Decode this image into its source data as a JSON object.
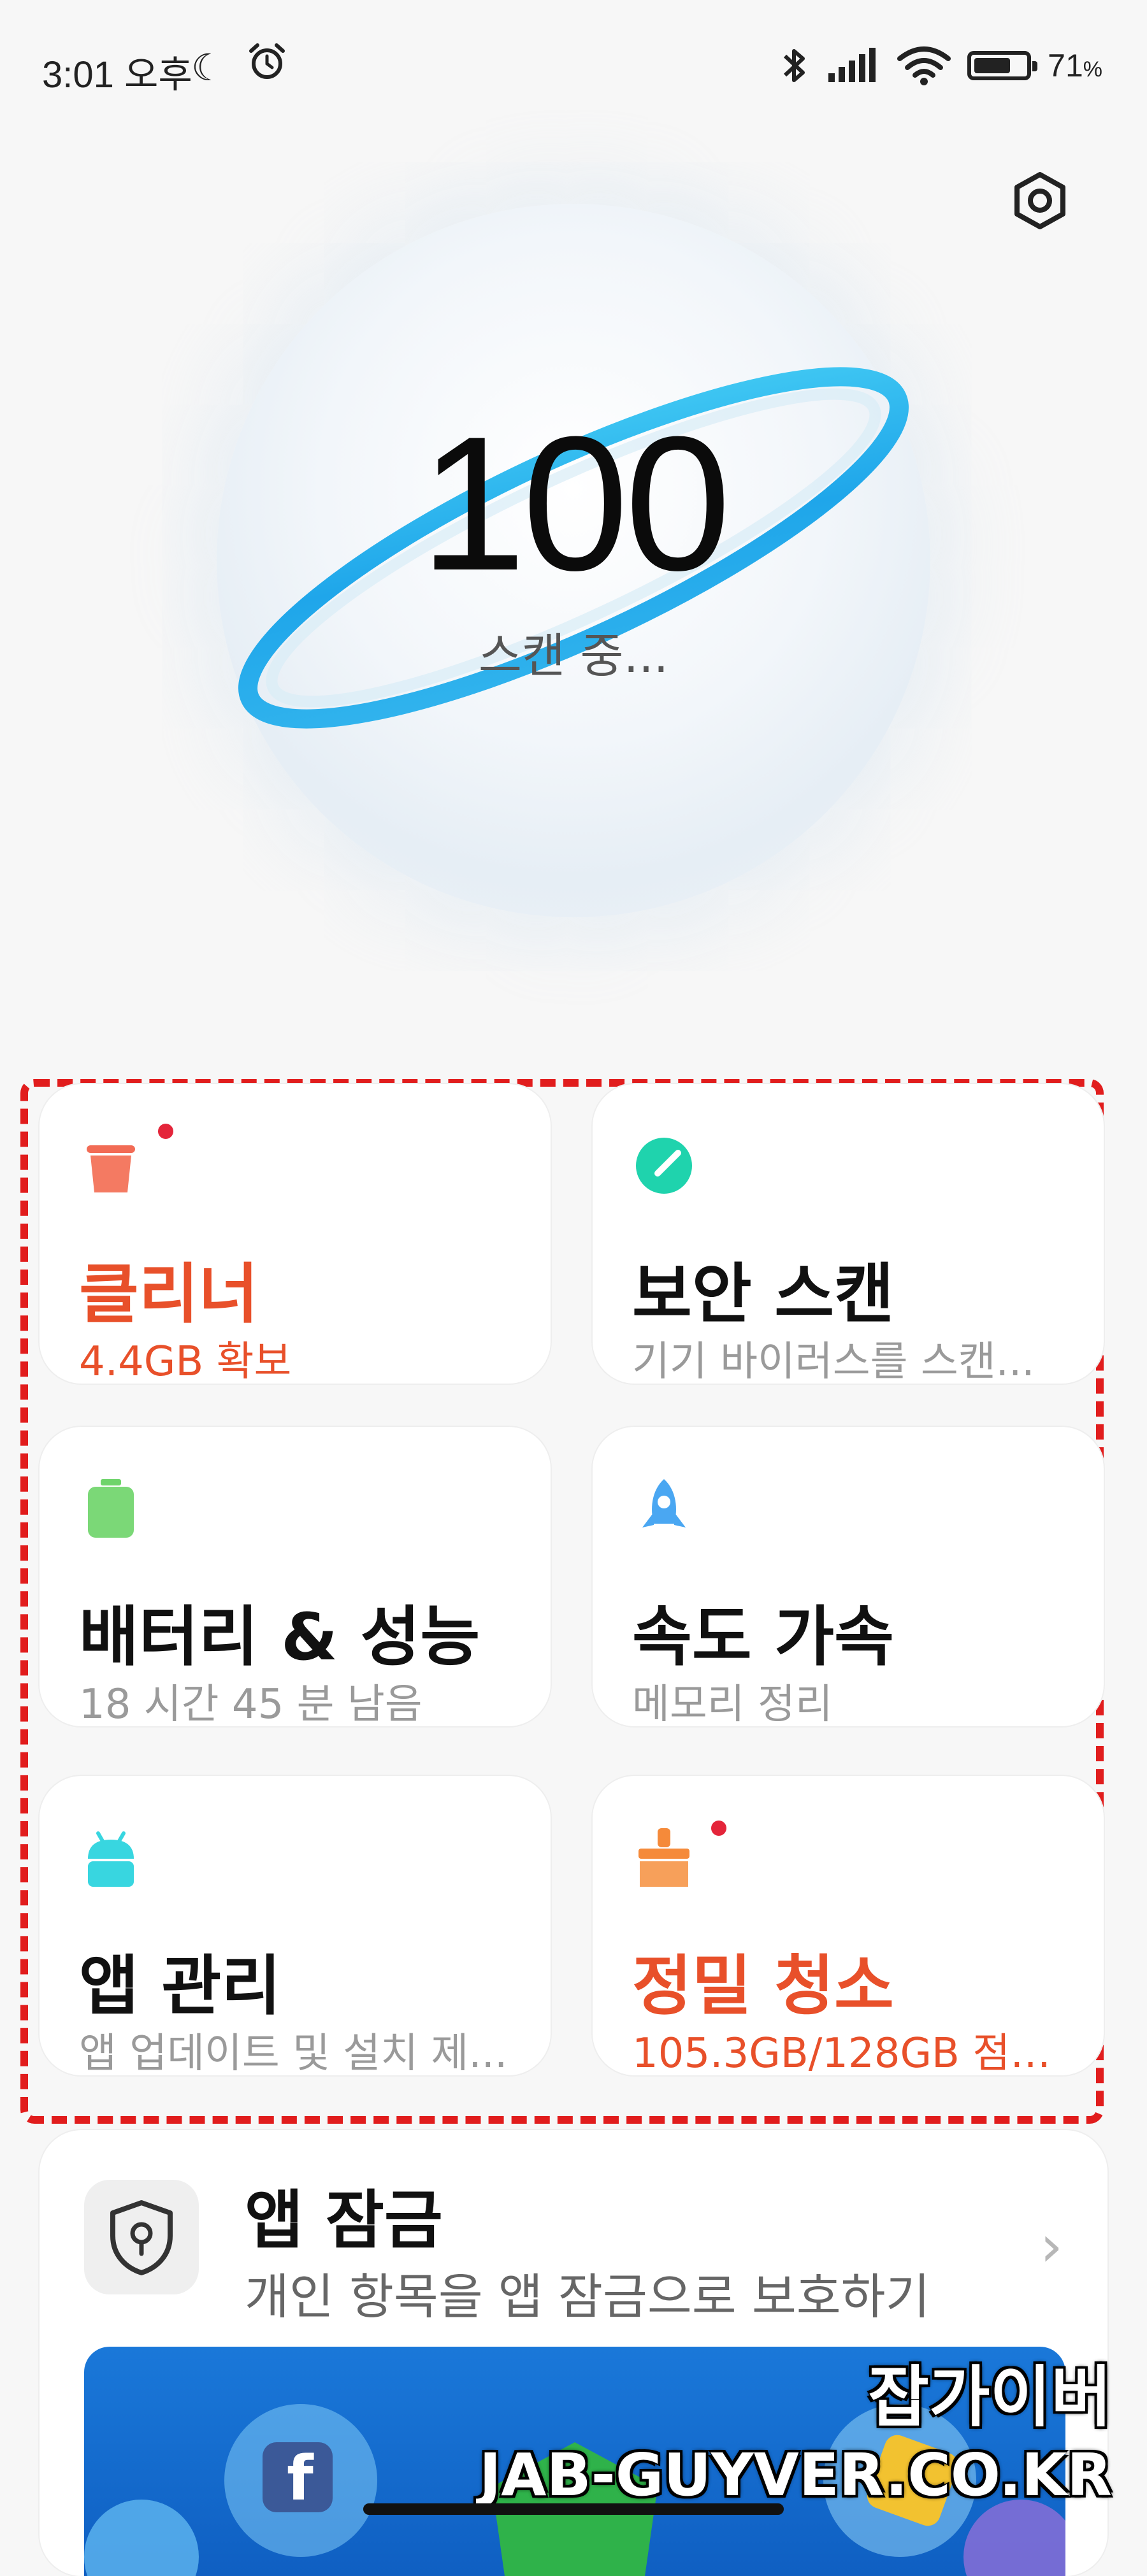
{
  "status_bar": {
    "time": "3:01 오후",
    "battery_percent": "71",
    "battery_unit": "%",
    "battery_level": 0.71
  },
  "hero": {
    "score": "100",
    "status": "스캔 중..."
  },
  "cards": [
    {
      "title": "클리너",
      "subtitle": "4.4GB 확보",
      "accent": "#e8502a",
      "icon": "trash-bin-icon",
      "badge": true
    },
    {
      "title": "보안 스캔",
      "subtitle": "기기 바이러스를 스캔...",
      "accent": "#1fd3ad",
      "icon": "shield-scan-icon",
      "badge": false
    },
    {
      "title": "배터리 & 성능",
      "subtitle": "18 시간 45 분  남음",
      "accent": "#6fd46b",
      "icon": "battery-icon",
      "badge": false
    },
    {
      "title": "속도 가속",
      "subtitle": "메모리 정리",
      "accent": "#4aa7f2",
      "icon": "rocket-icon",
      "badge": false
    },
    {
      "title": "앱 관리",
      "subtitle": "앱 업데이트 및 설치 제...",
      "accent": "#38d6e0",
      "icon": "android-icon",
      "badge": false
    },
    {
      "title": "정밀 청소",
      "subtitle": "105.3GB/128GB 점유...",
      "accent": "#f58a3a",
      "icon": "brush-icon",
      "badge": true
    }
  ],
  "app_lock": {
    "title": "앱 잠금",
    "subtitle": "개인 항목을 앱 잠금으로 보호하기"
  },
  "watermark": {
    "line1": "잡가이버",
    "line2": "JAB-GUYVER.CO.KR"
  }
}
